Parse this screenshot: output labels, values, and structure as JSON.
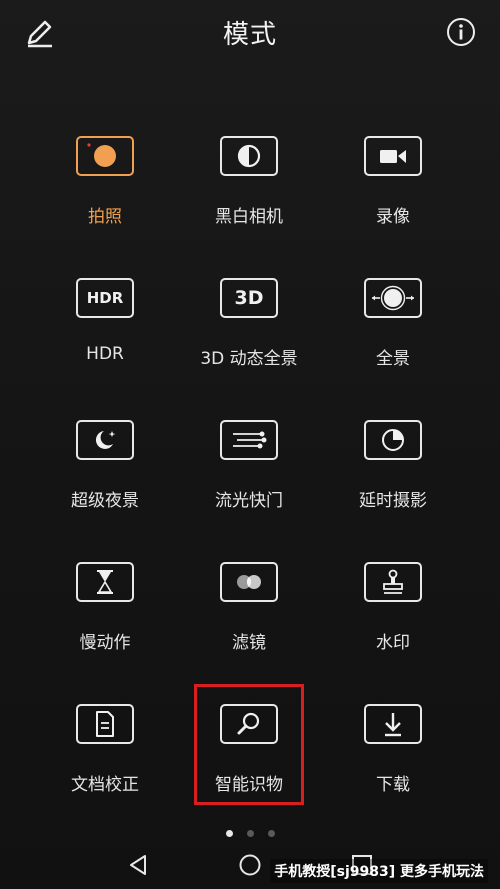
{
  "header": {
    "title": "模式",
    "edit_icon": "pencil-icon",
    "info_icon": "info-icon"
  },
  "modes": [
    {
      "label": "拍照",
      "icon": "photo-shutter-icon",
      "active": true
    },
    {
      "label": "黑白相机",
      "icon": "monochrome-icon"
    },
    {
      "label": "录像",
      "icon": "video-camera-icon"
    },
    {
      "label": "HDR",
      "icon": "hdr-icon",
      "icon_text": "HDR"
    },
    {
      "label": "3D 动态全景",
      "icon": "3d-panorama-icon",
      "icon_text": "3D"
    },
    {
      "label": "全景",
      "icon": "panorama-icon"
    },
    {
      "label": "超级夜景",
      "icon": "night-moon-icon"
    },
    {
      "label": "流光快门",
      "icon": "light-painting-icon"
    },
    {
      "label": "延时摄影",
      "icon": "timelapse-icon"
    },
    {
      "label": "慢动作",
      "icon": "hourglass-icon"
    },
    {
      "label": "滤镜",
      "icon": "filter-icon"
    },
    {
      "label": "水印",
      "icon": "stamp-icon"
    },
    {
      "label": "文档校正",
      "icon": "document-icon"
    },
    {
      "label": "智能识物",
      "icon": "magnifier-icon",
      "highlighted": true
    },
    {
      "label": "下载",
      "icon": "download-icon"
    }
  ],
  "pager": {
    "pages": 3,
    "current": 1
  },
  "navbar": [
    "back-icon",
    "home-icon",
    "recents-icon"
  ],
  "watermark": "手机教授[sj9983] 更多手机玩法",
  "colors": {
    "accent": "#f0a050",
    "highlight": "#d81e1e",
    "background": "#161616"
  }
}
